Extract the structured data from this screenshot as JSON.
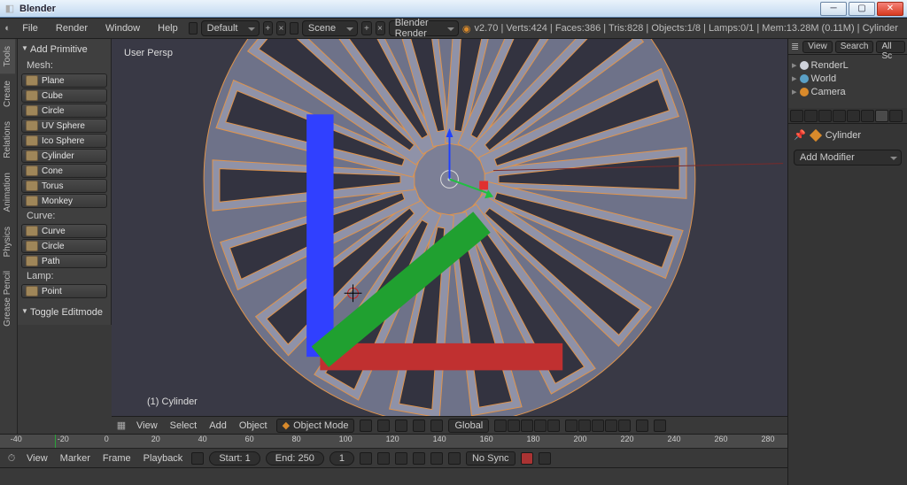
{
  "window": {
    "title": "Blender"
  },
  "menubar": {
    "items": [
      "File",
      "Render",
      "Window",
      "Help"
    ],
    "layout": "Default",
    "scene": "Scene",
    "render_engine": "Blender Render"
  },
  "stats": {
    "version": "v2.70",
    "verts": "Verts:424",
    "faces": "Faces:386",
    "tris": "Tris:828",
    "objects": "Objects:1/8",
    "lamps": "Lamps:0/1",
    "mem": "Mem:13.28M (0.11M)",
    "obj": "Cylinder"
  },
  "vtabs": [
    "Tools",
    "Create",
    "Relations",
    "Animation",
    "Physics",
    "Grease Pencil"
  ],
  "toolshelf": {
    "panel1": "Add Primitive",
    "mesh_label": "Mesh:",
    "mesh": [
      "Plane",
      "Cube",
      "Circle",
      "UV Sphere",
      "Ico Sphere",
      "Cylinder",
      "Cone",
      "Torus",
      "Monkey"
    ],
    "curve_label": "Curve:",
    "curve": [
      "Curve",
      "Circle",
      "Path"
    ],
    "lamp_label": "Lamp:",
    "lamp": [
      "Point"
    ],
    "panel2": "Toggle Editmode"
  },
  "viewport": {
    "persp": "User Persp",
    "obj_label": "(1) Cylinder"
  },
  "view3d_header": {
    "items": [
      "View",
      "Select",
      "Add",
      "Object"
    ],
    "mode": "Object Mode",
    "orient": "Global"
  },
  "timeline": {
    "ticks": [
      -40,
      -20,
      0,
      20,
      40,
      60,
      80,
      100,
      120,
      140,
      160,
      180,
      200,
      220,
      240,
      260,
      280
    ],
    "playhead": 0,
    "items": [
      "View",
      "Marker",
      "Frame",
      "Playback"
    ],
    "start_label": "Start:",
    "start_val": "1",
    "end_label": "End:",
    "end_val": "250",
    "cur": "1",
    "sync": "No Sync"
  },
  "outliner": {
    "hdr": [
      "View",
      "Search",
      "All Sc"
    ],
    "rows": [
      {
        "name": "RenderL",
        "color": "#cfd3db"
      },
      {
        "name": "World",
        "color": "#5aa0c6"
      },
      {
        "name": "Camera",
        "color": "#d98a2b"
      }
    ]
  },
  "properties": {
    "obj": "Cylinder",
    "add_mod": "Add Modifier"
  }
}
